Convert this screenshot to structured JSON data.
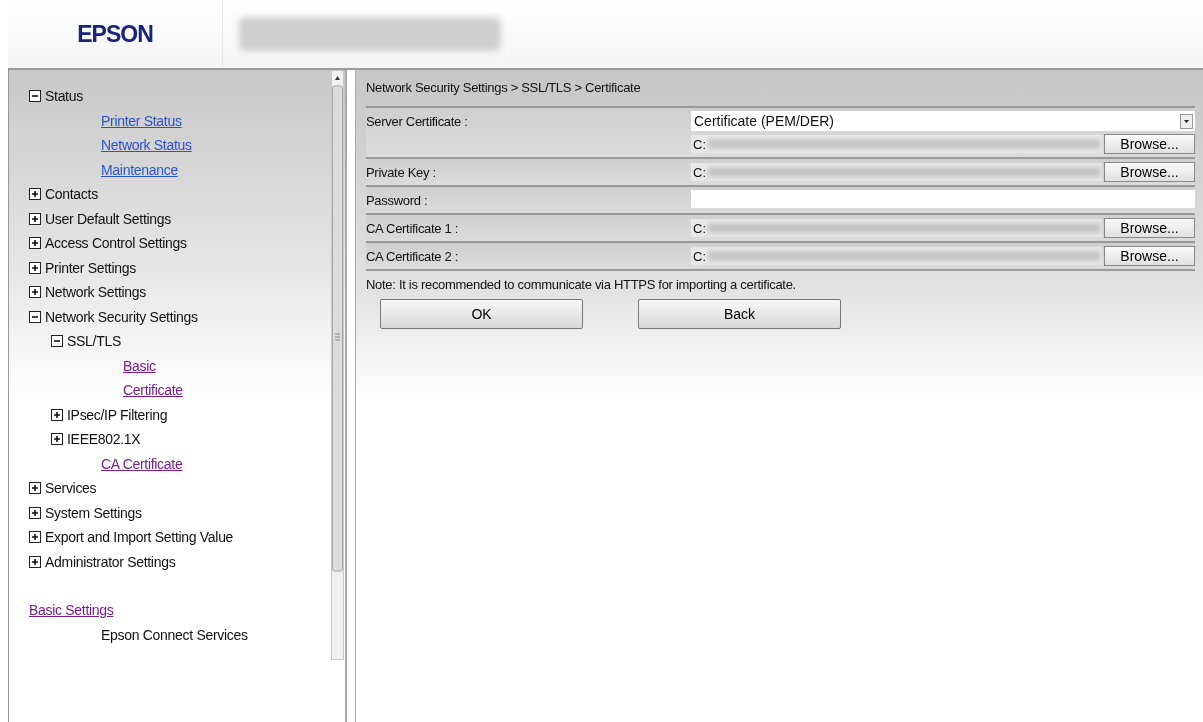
{
  "header": {
    "logo": "EPSON"
  },
  "sidebar": {
    "items": [
      {
        "kind": "group",
        "label": "Status",
        "expanded": true,
        "children": [
          {
            "kind": "link",
            "label": "Printer Status",
            "visited": false
          },
          {
            "kind": "link",
            "label": "Network Status",
            "visited": false
          },
          {
            "kind": "link",
            "label": "Maintenance",
            "visited": false
          }
        ]
      },
      {
        "kind": "group",
        "label": "Contacts",
        "expanded": false
      },
      {
        "kind": "group",
        "label": "User Default Settings",
        "expanded": false
      },
      {
        "kind": "group",
        "label": "Access Control Settings",
        "expanded": false
      },
      {
        "kind": "group",
        "label": "Printer Settings",
        "expanded": false
      },
      {
        "kind": "group",
        "label": "Network Settings",
        "expanded": false
      },
      {
        "kind": "group",
        "label": "Network Security Settings",
        "expanded": true,
        "children": [
          {
            "kind": "group",
            "label": "SSL/TLS",
            "expanded": true,
            "children": [
              {
                "kind": "link",
                "label": "Basic",
                "visited": true
              },
              {
                "kind": "link",
                "label": "Certificate",
                "visited": true
              }
            ]
          },
          {
            "kind": "group",
            "label": "IPsec/IP Filtering",
            "expanded": false
          },
          {
            "kind": "group",
            "label": "IEEE802.1X",
            "expanded": false
          },
          {
            "kind": "link",
            "label": "CA Certificate",
            "visited": true
          }
        ]
      },
      {
        "kind": "group",
        "label": "Services",
        "expanded": false
      },
      {
        "kind": "group",
        "label": "System Settings",
        "expanded": false
      },
      {
        "kind": "group",
        "label": "Export and Import Setting Value",
        "expanded": false
      },
      {
        "kind": "group",
        "label": "Administrator Settings",
        "expanded": false
      },
      {
        "kind": "spacer"
      },
      {
        "kind": "link",
        "label": "Basic Settings",
        "visited": true,
        "children": [
          {
            "kind": "text",
            "label": "Epson Connect Services"
          }
        ]
      }
    ]
  },
  "main": {
    "breadcrumb": "Network Security Settings > SSL/TLS > Certificate",
    "rows": [
      {
        "label": "Server Certificate :",
        "kind": "select-file",
        "value": "Certificate (PEM/DER)",
        "path": "C:",
        "button": "Browse..."
      },
      {
        "label": "Private Key :",
        "kind": "file",
        "path": "C:",
        "button": "Browse..."
      },
      {
        "label": "Password :",
        "kind": "text"
      },
      {
        "label": "CA Certificate 1 :",
        "kind": "file",
        "path": "C:",
        "button": "Browse..."
      },
      {
        "label": "CA Certificate 2 :",
        "kind": "file",
        "path": "C:",
        "button": "Browse..."
      }
    ],
    "note": "Note: It is recommended to communicate via HTTPS for importing a certificate.",
    "buttons": [
      "OK",
      "Back"
    ]
  }
}
